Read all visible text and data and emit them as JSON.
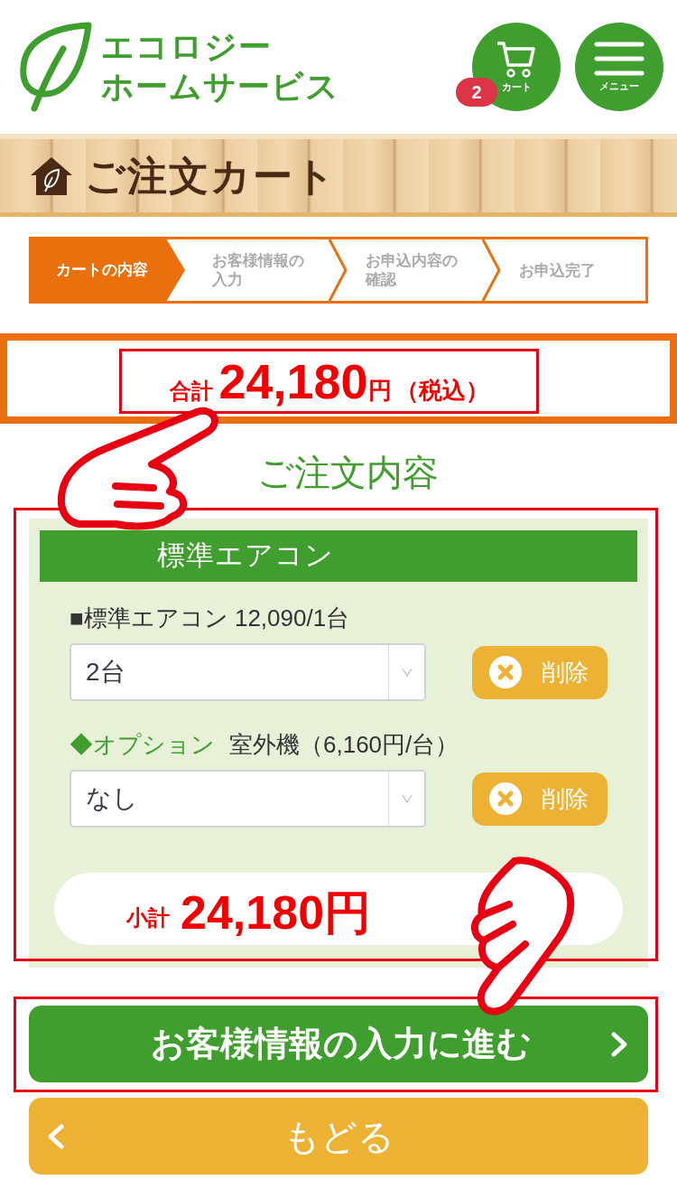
{
  "header": {
    "logo_lines": [
      "エコロジー",
      "ホームサービス"
    ],
    "cart": {
      "label": "カート",
      "badge": "2"
    },
    "menu": {
      "label": "メニュー"
    }
  },
  "page_title": "ご注文カート",
  "steps": [
    {
      "label": "カートの内容",
      "selected": true
    },
    {
      "label": "お客様情報の入力",
      "selected": false
    },
    {
      "label": "お申込内容の確認",
      "selected": false
    },
    {
      "label": "お申込完了",
      "selected": false
    }
  ],
  "total": {
    "label": "合計",
    "amount": "24,180",
    "unit": "円",
    "tax_note": "（税込）"
  },
  "order_heading": "ご注文内容",
  "order": {
    "category": "標準エアコン",
    "lines": [
      {
        "kind": "product",
        "name": "■標準エアコン 12,090/1台",
        "select_value": "2台",
        "delete_label": "削除"
      },
      {
        "kind": "option",
        "tag": "◆オプション",
        "name": "室外機（6,160円/台）",
        "select_value": "なし",
        "delete_label": "削除"
      }
    ],
    "subtotal": {
      "label": "小計",
      "amount": "24,180円"
    }
  },
  "next_button": "お客様情報の入力に進む",
  "back_button": "もどる"
}
